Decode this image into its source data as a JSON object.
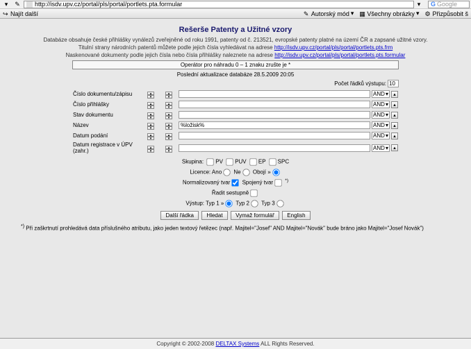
{
  "browser": {
    "url": "http://isdv.upv.cz/portal/pls/portal/portlets.pta.formular",
    "search_placeholder": "Google"
  },
  "toolbar": {
    "najit": "Najít další",
    "autorsky": "Autorský mód",
    "obrazky": "Všechny obrázky",
    "prizpusobit": "Přizpůsobit š"
  },
  "page": {
    "title": "Rešerše Patenty a Užitné vzory",
    "desc1": "Databáze obsahuje české přihlášky vynálezů zveřejněné od roku 1991, patenty od č. 213521, evropské patenty platné na území ČR a zapsané užitné vzory.",
    "desc2a": "Titulní strany národních patentů můžete podle jejich čísla vyhledávat na adrese ",
    "desc2link": "http://isdv.upv.cz/portal/pls/portal/portlets.pts.frm",
    "desc3a": "Naskenované dokumenty podle jejich čísla nebo čísla přihlášky naleznete na adrese ",
    "desc3link": "http://isdv.upv.cz/portal/pls/portal/portlets.pts.formular",
    "op_hint": "Operátor pro náhradu 0 – 1 znaku zrušte je *",
    "last_update": "Poslední aktualizace databáze 28.5.2009 20:05",
    "count_label": "Počet řádků výstupu:",
    "count_value": "10"
  },
  "fields": [
    {
      "label": "Číslo dokumentu/zápisu",
      "value": "",
      "op": "AND"
    },
    {
      "label": "Číslo přihlášky",
      "value": "",
      "op": "AND"
    },
    {
      "label": "Stav dokumentu",
      "value": "",
      "op": "AND"
    },
    {
      "label": "Název",
      "value": "%ložisk%",
      "op": "AND"
    },
    {
      "label": "Datum podání",
      "value": "",
      "op": "AND"
    },
    {
      "label": "Datum registrace v ÚPV (zahr.)",
      "value": "",
      "op": "AND"
    }
  ],
  "opts": {
    "skupina_label": "Skupina:",
    "skupina_pv": "PV",
    "skupina_puv": "PUV",
    "skupina_ep": "EP",
    "skupina_spc": "SPC",
    "licence_label": "Licence:",
    "licence_ano": "Ano",
    "licence_ne": "Ne",
    "licence_oboje": "Obojí »",
    "norm_label": "Normalizovaný tvar",
    "spoj_label": "Spojený tvar",
    "radit_label": "Řadit sestupně",
    "vystup_label": "Výstup:",
    "vystup_1": "Typ 1 »",
    "vystup_2": "Typ 2",
    "vystup_3": "Typ 3"
  },
  "buttons": {
    "dalsi": "Další řádka",
    "hledat": "Hledat",
    "vymaz": "Vymaž formulář",
    "english": "English"
  },
  "footnote": "Při zaškrtnutí prohledává data příslušného atributu, jako jeden textový řetězec (např. Majitel=\"Josef\" AND Majitel=\"Novák\" bude bráno jako Majitel=\"Josef Novák\")",
  "footer": {
    "copy_a": "Copyright © 2002-2008 ",
    "link": "DELTAX Systems",
    "copy_b": " ALL Rights Reserved."
  }
}
